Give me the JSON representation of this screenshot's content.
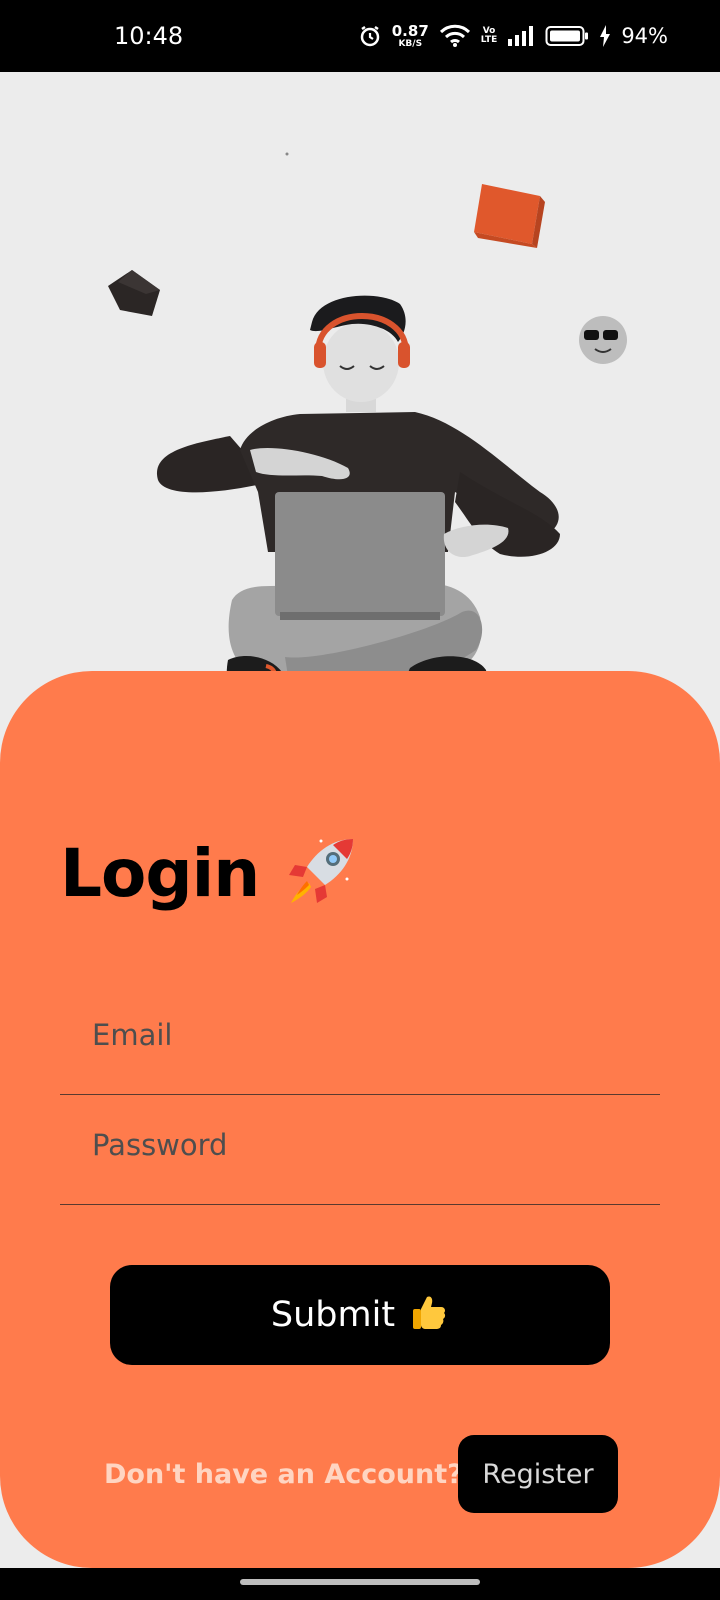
{
  "status_bar": {
    "time": "10:48",
    "net_speed_value": "0.87",
    "net_speed_unit": "KB/S",
    "volte_top": "Vo",
    "volte_bottom": "LTE",
    "battery_percent": "94%",
    "icons": [
      "alarm-icon",
      "wifi-icon",
      "signal-icon",
      "battery-icon",
      "charging-bolt-icon"
    ]
  },
  "illustration": {
    "subject": "person-with-laptop-illustration",
    "floating_items": [
      "orange-cube",
      "dark-cube",
      "sunglasses-emoji-ball"
    ]
  },
  "login": {
    "title": "Login",
    "title_emoji": "🚀",
    "email_placeholder": "Email",
    "password_placeholder": "Password",
    "submit_label": "Submit",
    "submit_emoji": "👍",
    "register_prompt": "Don't have an Account?",
    "register_label": "Register"
  },
  "colors": {
    "card": "#ff7b4c",
    "background": "#ececec",
    "button": "#000000"
  }
}
